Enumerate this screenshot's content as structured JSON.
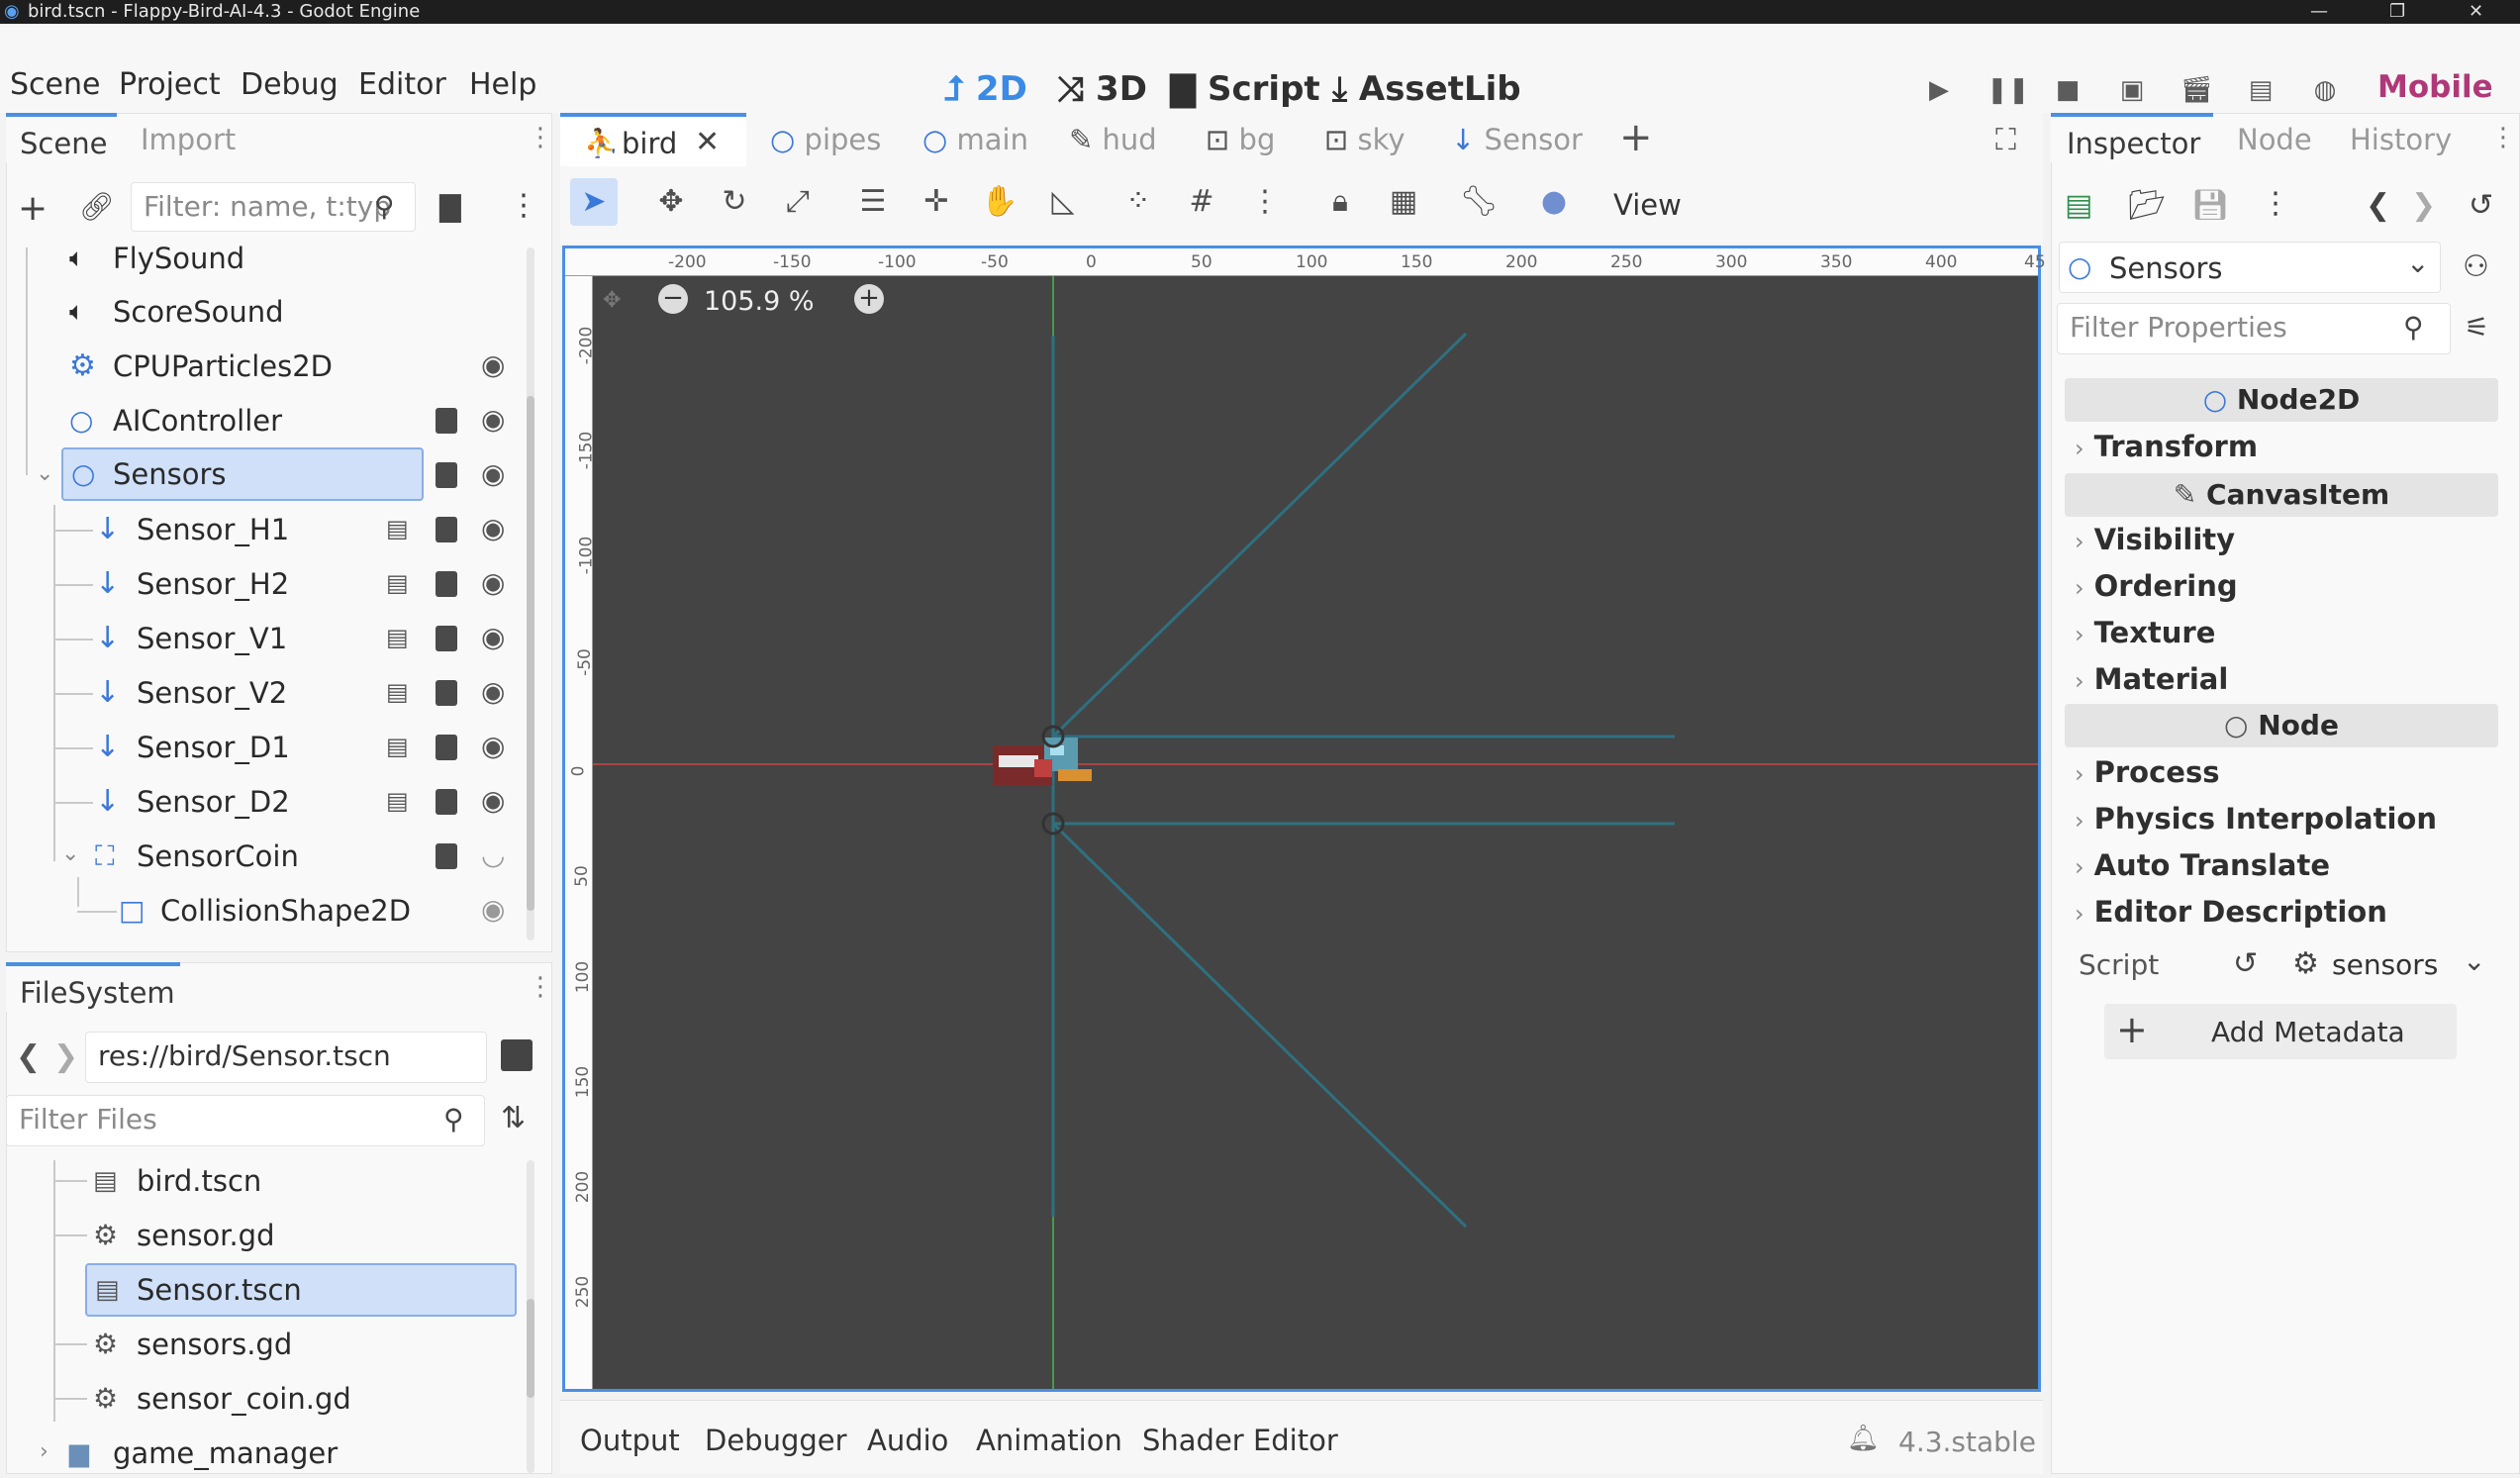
{
  "window": {
    "title": "bird.tscn - Flappy-Bird-AI-4.3 - Godot Engine"
  },
  "menu": [
    "Scene",
    "Project",
    "Debug",
    "Editor",
    "Help"
  ],
  "workspaces": [
    {
      "label": "2D",
      "icon": "2d-icon",
      "active": true
    },
    {
      "label": "3D",
      "icon": "3d-icon",
      "active": false
    },
    {
      "label": "Script",
      "icon": "script-icon",
      "active": false
    },
    {
      "label": "AssetLib",
      "icon": "assetlib-icon",
      "active": false
    }
  ],
  "renderer": "Mobile",
  "scene_dock": {
    "tabs": [
      "Scene",
      "Import"
    ],
    "filter_placeholder": "Filter: name, t:typ",
    "nodes": [
      {
        "label": "FlySound",
        "icon": "audio-icon"
      },
      {
        "label": "ScoreSound",
        "icon": "audio-icon"
      },
      {
        "label": "CPUParticles2D",
        "icon": "particles-icon"
      },
      {
        "label": "AIController",
        "icon": "node2d-icon"
      },
      {
        "label": "Sensors",
        "icon": "node2d-icon",
        "selected": true
      },
      {
        "label": "Sensor_H1",
        "icon": "raycast-icon"
      },
      {
        "label": "Sensor_H2",
        "icon": "raycast-icon"
      },
      {
        "label": "Sensor_V1",
        "icon": "raycast-icon"
      },
      {
        "label": "Sensor_V2",
        "icon": "raycast-icon"
      },
      {
        "label": "Sensor_D1",
        "icon": "raycast-icon"
      },
      {
        "label": "Sensor_D2",
        "icon": "raycast-icon"
      },
      {
        "label": "SensorCoin",
        "icon": "area2d-icon"
      },
      {
        "label": "CollisionShape2D",
        "icon": "collisionshape-icon"
      }
    ]
  },
  "filesystem": {
    "tab": "FileSystem",
    "path": "res://bird/Sensor.tscn",
    "filter_placeholder": "Filter Files",
    "files": [
      {
        "label": "bird.tscn",
        "icon": "scene-file-icon"
      },
      {
        "label": "sensor.gd",
        "icon": "gear-icon"
      },
      {
        "label": "Sensor.tscn",
        "icon": "scene-file-icon",
        "selected": true
      },
      {
        "label": "sensors.gd",
        "icon": "gear-icon"
      },
      {
        "label": "sensor_coin.gd",
        "icon": "gear-icon"
      },
      {
        "label": "game_manager",
        "icon": "folder-icon"
      }
    ]
  },
  "scene_tabs": [
    "bird",
    "pipes",
    "main",
    "hud",
    "bg",
    "sky",
    "Sensor"
  ],
  "viewport": {
    "zoom": "105.9 %",
    "view_label": "View",
    "ruler_x": [
      "-200",
      "-150",
      "-100",
      "-50",
      "0",
      "50",
      "100",
      "150",
      "200",
      "250",
      "300",
      "350",
      "400",
      "45"
    ],
    "ruler_y": [
      "-200",
      "-150",
      "-100",
      "-50",
      "0",
      "50",
      "100",
      "150",
      "200",
      "250"
    ]
  },
  "bottom_panel": {
    "tabs": [
      "Output",
      "Debugger",
      "Audio",
      "Animation",
      "Shader Editor"
    ],
    "version": "4.3.stable"
  },
  "inspector": {
    "tabs": [
      "Inspector",
      "Node",
      "History"
    ],
    "node_name": "Sensors",
    "filter_placeholder": "Filter Properties",
    "sections": [
      {
        "type": "header",
        "label": "Node2D"
      },
      {
        "type": "group",
        "label": "Transform"
      },
      {
        "type": "header",
        "label": "CanvasItem"
      },
      {
        "type": "group",
        "label": "Visibility"
      },
      {
        "type": "group",
        "label": "Ordering"
      },
      {
        "type": "group",
        "label": "Texture"
      },
      {
        "type": "group",
        "label": "Material"
      },
      {
        "type": "header",
        "label": "Node"
      },
      {
        "type": "group",
        "label": "Process"
      },
      {
        "type": "group",
        "label": "Physics Interpolation"
      },
      {
        "type": "group",
        "label": "Auto Translate"
      },
      {
        "type": "group",
        "label": "Editor Description"
      }
    ],
    "script_label": "Script",
    "script_value": "sensors",
    "add_metadata": "Add Metadata"
  }
}
